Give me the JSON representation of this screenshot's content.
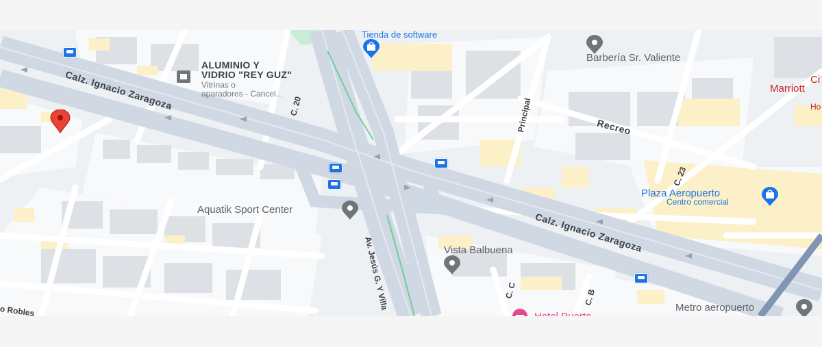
{
  "colors": {
    "background": "#eef1f4",
    "major_road": "#cfd8e3",
    "building": "#dde1e6",
    "block": "#f8f9fa",
    "commercial": "#fcf0c8",
    "park": "#c8ecd5",
    "poi_blue": "#1a73e8",
    "poi_gray": "#70757a",
    "marker_red": "#ea4335",
    "hotel_pink": "#e8478b"
  },
  "places": {
    "aluminio_line1": "ALUMINIO Y",
    "aluminio_line2": "VIDRIO \"REY GUZ\"",
    "aluminio_sub1": "Vitrinas o",
    "aluminio_sub2": "aparadores - Cancel...",
    "tienda": "Tienda de software",
    "barberia": "Barbería Sr. Valiente",
    "marriott_top": "Ci",
    "marriott": "Marriott",
    "marriott_sub": "Ho",
    "plaza": "Plaza Aeropuerto",
    "plaza_sub": "Centro comercial",
    "aquatik": "Aquatik Sport Center",
    "vista": "Vista Balbuena",
    "metro": "Metro aeropuerto",
    "hotel": "Hotel Puerto"
  },
  "streets": {
    "zaragoza_1": "Calz. Ignacio Zaragoza",
    "zaragoza_2": "Calz. Ignacio Zaragoza",
    "c20": "C. 20",
    "principal": "Principal",
    "recreo": "Recreo",
    "c23": "C. 23",
    "jesus_villa": "Av. Jesús G. Y Villa",
    "cc": "C. C",
    "cb": "C. B",
    "robles": "o Robles"
  },
  "icons": {
    "selected_marker": "red-location-pin-icon",
    "place_pin": "gray-place-pin-icon",
    "shopping": "shopping-bag-icon",
    "transit": "bus-stop-icon",
    "hotel": "bed-icon"
  }
}
